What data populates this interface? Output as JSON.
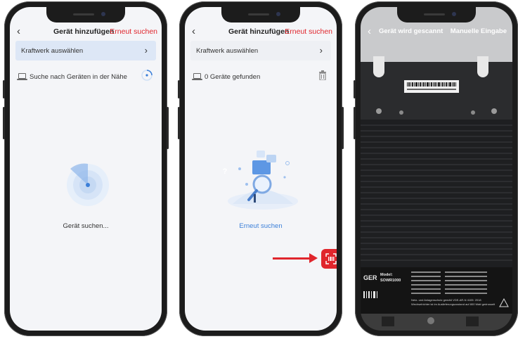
{
  "phone1": {
    "header": {
      "back": "‹",
      "title": "Gerät hinzufügen",
      "link": "Erneut suchen"
    },
    "select_plant": {
      "label": "Kraftwerk auswählen",
      "chevron": "›"
    },
    "status": {
      "label": "Suche nach Geräten in der Nähe",
      "icon": "laptop-icon"
    },
    "searching_text": "Gerät suchen..."
  },
  "phone2": {
    "header": {
      "back": "‹",
      "title": "Gerät hinzufügen",
      "link": "Erneut suchen"
    },
    "select_plant": {
      "label": "Kraftwerk auswählen",
      "chevron": "›"
    },
    "status": {
      "label": "0 Geräte gefunden",
      "icon": "laptop-icon"
    },
    "empty_illustration_mark": "?",
    "retry_text": "Erneut suchen"
  },
  "phone3": {
    "header": {
      "back": "‹",
      "title": "Gerät wird gescannt",
      "link": "Manuelle Eingabe"
    },
    "label": {
      "brand": "GER",
      "model_caption": "Model:",
      "model": "SOWR1000",
      "certification": "Netz- und Anlagenschutz gemäß VDE-AR-N 4105: 2018",
      "note": "Wechselrichter ist im Auslieferungszustand auf 800 Watt gedrosselt"
    }
  },
  "colors": {
    "accent": "#e0262d",
    "link_blue": "#3b7fd8",
    "select_bg": "#dde7f6"
  }
}
